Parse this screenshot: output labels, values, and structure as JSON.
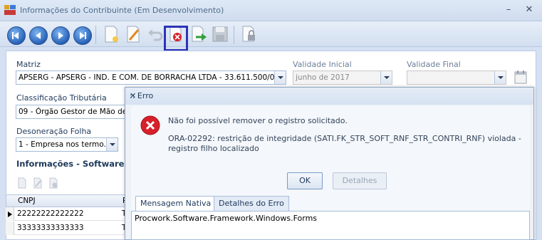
{
  "window": {
    "title": "Informações do Contribuinte (Em Desenvolvimento)"
  },
  "toolbar": {
    "buttons": [
      "first-icon",
      "previous-icon",
      "next-icon",
      "last-icon",
      "new-icon",
      "edit-icon",
      "undo-icon",
      "delete-icon",
      "export-icon",
      "save-icon",
      "lock-icon"
    ],
    "highlight_color": "#2b34b9"
  },
  "form": {
    "matriz_label": "Matriz",
    "matriz_value": "APSERG - APSERG - IND. E COM. DE BORRACHA LTDA - 33.611.500/00...",
    "validade_inicial_label": "Validade Inicial",
    "validade_inicial_value": "junho de 2017",
    "validade_final_label": "Validade Final",
    "validade_final_value": "",
    "classificacao_label": "Classificação Tributária",
    "classificacao_value": "09 - Órgão Gestor de Mão de O",
    "desoneracao_label": "Desoneração Folha",
    "desoneracao_value": "1 - Empresa nos termo..."
  },
  "software_section": {
    "title": "Informações - Software Ho",
    "grid_header": "CNPJ",
    "grid_header_partial": "R",
    "rows": [
      {
        "cnpj": "22222222222222",
        "extra": "T"
      },
      {
        "cnpj": "33333333333333",
        "extra": "T"
      }
    ]
  },
  "dialog": {
    "title": ":: Erro",
    "message": "Não foi possível remover o registro solicitado.",
    "detail": "ORA-02292: restrição de integridade (SATI.FK_STR_SOFT_RNF_STR_CONTRI_RNF) violada - registro filho localizado",
    "ok_label": "OK",
    "details_label": "Detalhes",
    "tabs": [
      "Mensagem Nativa",
      "Detalhes do Erro"
    ],
    "tab_content": "Procwork.Software.Framework.Windows.Forms",
    "error_color": "#d7202a"
  }
}
